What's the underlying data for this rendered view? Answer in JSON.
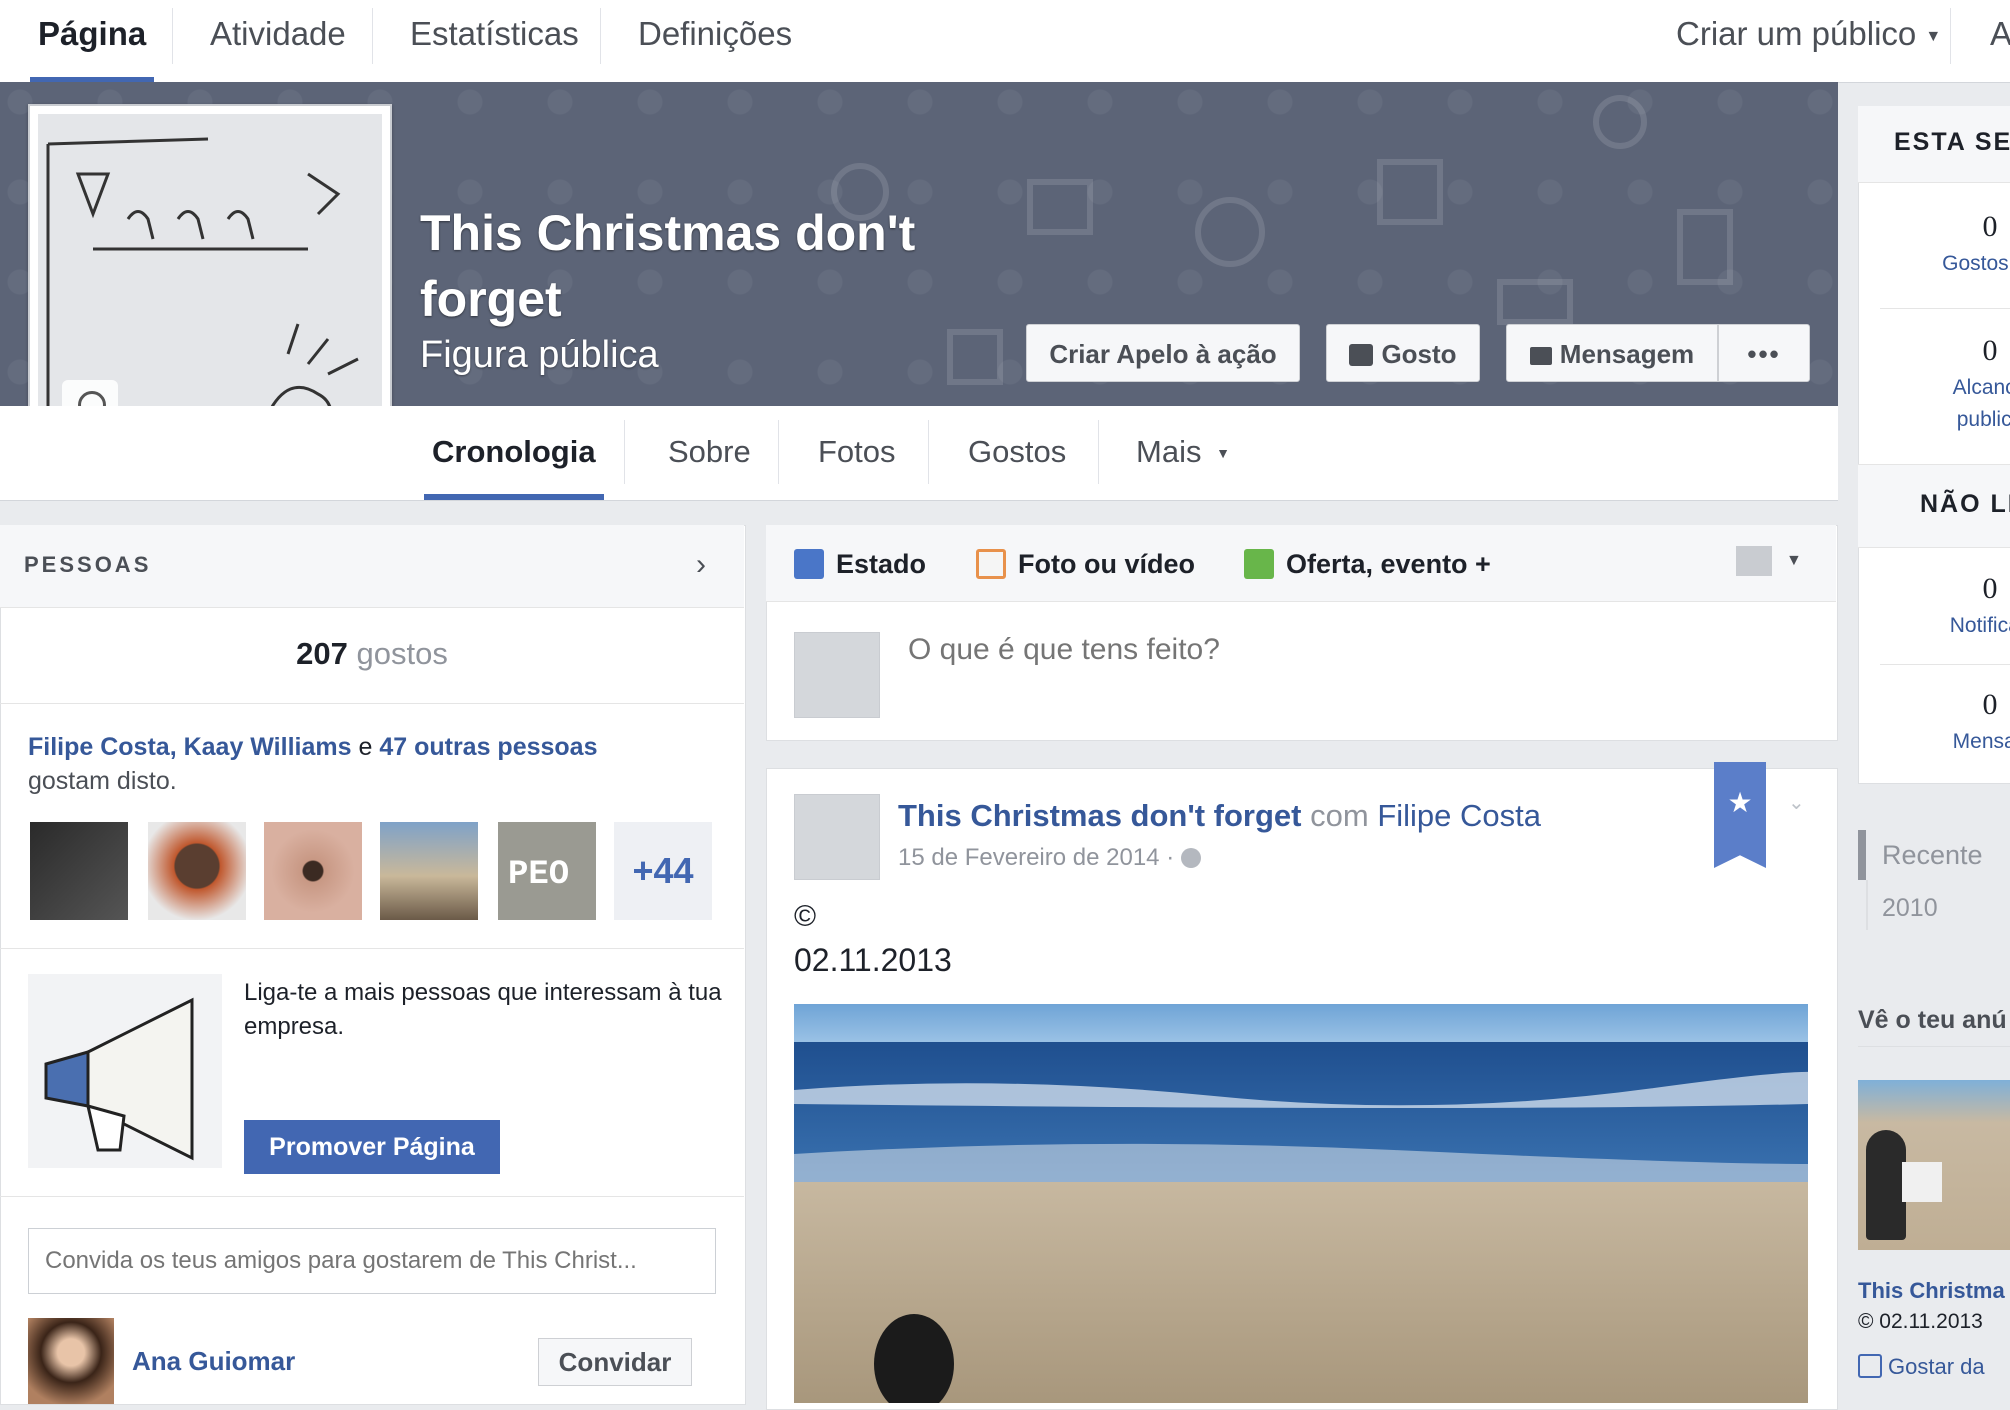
{
  "top_nav": {
    "tabs": [
      "Página",
      "Atividade",
      "Estatísticas",
      "Definições"
    ],
    "audience": "Criar um público",
    "truncated_right": "A"
  },
  "page": {
    "title": "This Christmas don't forget",
    "category": "Figura pública",
    "actions": {
      "cta": "Criar Apelo à ação",
      "like": "Gosto",
      "message": "Mensagem",
      "more": "•••"
    },
    "tabs": [
      "Cronologia",
      "Sobre",
      "Fotos",
      "Gostos",
      "Mais"
    ]
  },
  "people": {
    "heading": "PESSOAS",
    "likes_count": "207",
    "likes_label": "gostos",
    "friend1": "Filipe Costa",
    "friend2": "Kaay Williams",
    "connector": "e",
    "others": "47 outras pessoas",
    "like_this": "gostam disto.",
    "more_count": "+44",
    "promote_text": "Liga-te a mais pessoas que interessam à tua empresa.",
    "promote_button": "Promover Página",
    "invite_placeholder": "Convida os teus amigos para gostarem de This Christ...",
    "invite_name": "Ana Guiomar",
    "invite_button": "Convidar"
  },
  "composer": {
    "tab_status": "Estado",
    "tab_photo": "Foto ou vídeo",
    "tab_offer": "Oferta, evento +",
    "placeholder": "O que é que tens feito?"
  },
  "post": {
    "author": "This Christmas don't forget",
    "with": "com",
    "with_person": "Filipe Costa",
    "date": "15 de Fevereiro de 2014",
    "separator": "·",
    "copyright": "©",
    "body": "02.11.2013"
  },
  "right": {
    "heading": "ESTA SE",
    "stat1_value": "0",
    "stat1_label": "Gostos da",
    "stat2_value": "0",
    "stat2_label_1": "Alcance",
    "stat2_label_2": "publica",
    "heading2": "NÃO LI",
    "stat3_value": "0",
    "stat3_label": "Notificaç",
    "stat4_value": "0",
    "stat4_label": "Mensag",
    "timeline_recent": "Recente",
    "timeline_year": "2010",
    "ad_heading": "Vê o teu anú",
    "ad_title": "This Christma",
    "ad_text": "© 02.11.2013",
    "ad_like": "Gostar da"
  },
  "colors": {
    "brand_blue": "#4267b2",
    "link_blue": "#365899",
    "cover_bg": "#5c6477",
    "page_bg": "#e9ebee"
  }
}
